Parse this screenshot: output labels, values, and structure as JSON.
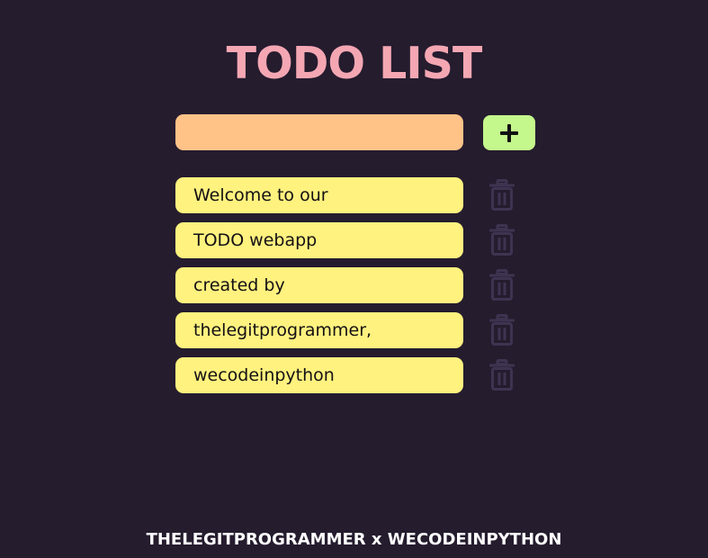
{
  "app": {
    "title": "TODO LIST"
  },
  "input": {
    "value": "",
    "placeholder": ""
  },
  "add_button": {
    "icon": "plus-icon"
  },
  "todos": [
    {
      "text": "Welcome to our",
      "delete_icon": "trash-icon"
    },
    {
      "text": "TODO webapp",
      "delete_icon": "trash-icon"
    },
    {
      "text": "created by",
      "delete_icon": "trash-icon"
    },
    {
      "text": "thelegitprogrammer,",
      "delete_icon": "trash-icon"
    },
    {
      "text": "wecodeinpython",
      "delete_icon": "trash-icon"
    }
  ],
  "footer": {
    "text": "THELEGITPROGRAMMER x WECODEINPYTHON"
  },
  "colors": {
    "background": "#251c2e",
    "title": "#f4a7b3",
    "input": "#ffc287",
    "add_button": "#c4f78c",
    "todo_item": "#fff27f",
    "trash_icon": "#3e3451"
  }
}
